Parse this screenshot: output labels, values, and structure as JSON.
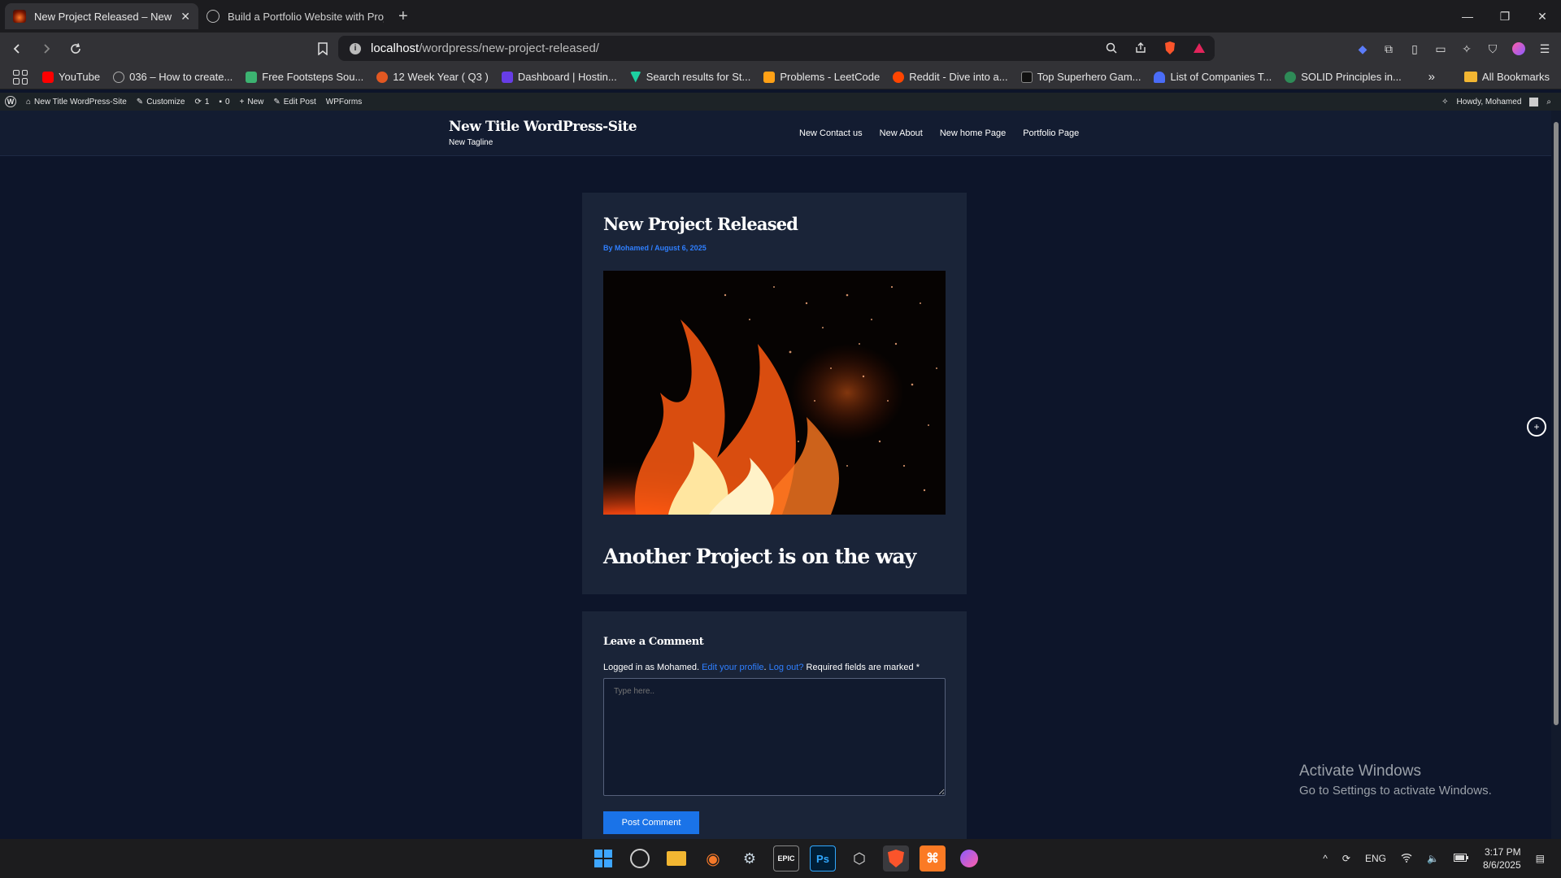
{
  "browser": {
    "tabs": [
      {
        "label": "New Project Released – New Title",
        "active": true
      },
      {
        "label": "Build a Portfolio Website with Project",
        "active": false
      }
    ],
    "new_tab_symbol": "+",
    "window_controls": {
      "minimize": "—",
      "restore": "❐",
      "close": "✕"
    },
    "url_host": "localhost",
    "url_path": "/wordpress/new-project-released/",
    "bookmarks": [
      {
        "label": "YouTube",
        "color": "#ff0000"
      },
      {
        "label": "036 – How to create...",
        "color": "#888888"
      },
      {
        "label": "Free Footsteps Sou...",
        "color": "#3cb371"
      },
      {
        "label": "12 Week Year ( Q3 )",
        "color": "#e25822"
      },
      {
        "label": "Dashboard | Hostin...",
        "color": "#673de6"
      },
      {
        "label": "Search results for St...",
        "color": "#1dd1a1"
      },
      {
        "label": "Problems - LeetCode",
        "color": "#ffa116"
      },
      {
        "label": "Reddit - Dive into a...",
        "color": "#ff4500"
      },
      {
        "label": "Top Superhero Gam...",
        "color": "#222222"
      },
      {
        "label": "List of Companies T...",
        "color": "#4a6cf7"
      },
      {
        "label": "SOLID Principles in...",
        "color": "#2e8b57"
      }
    ],
    "bookmarks_overflow": "»",
    "all_bookmarks": "All Bookmarks"
  },
  "wp_admin_bar": {
    "site_name": "New Title WordPress-Site",
    "customize": "Customize",
    "updates": "1",
    "comments": "0",
    "new": "New",
    "edit_post": "Edit Post",
    "wpforms": "WPForms",
    "howdy": "Howdy, Mohamed"
  },
  "site": {
    "title": "New Title WordPress-Site",
    "tagline": "New Tagline",
    "menu": [
      "New Contact us",
      "New About",
      "New home Page",
      "Portfolio Page"
    ]
  },
  "post": {
    "title": "New Project Released",
    "meta": "By Mohamed / August 6, 2025",
    "heading": "Another Project is on the way"
  },
  "comment_form": {
    "heading": "Leave a Comment",
    "logged_in_prefix": "Logged in as Mohamed.",
    "edit_profile": "Edit your profile",
    "logout": "Log out?",
    "required": "Required fields are marked",
    "required_mark": "*",
    "placeholder": "Type here..",
    "submit": "Post Comment"
  },
  "watermark": {
    "line1": "Activate Windows",
    "line2": "Go to Settings to activate Windows."
  },
  "taskbar": {
    "language": "ENG",
    "time": "3:17 PM",
    "date": "8/6/2025"
  },
  "colors": {
    "accent_link": "#2f7fff",
    "button": "#1a73e8",
    "page_bg": "#0d152a",
    "card_bg": "#1a2438"
  }
}
